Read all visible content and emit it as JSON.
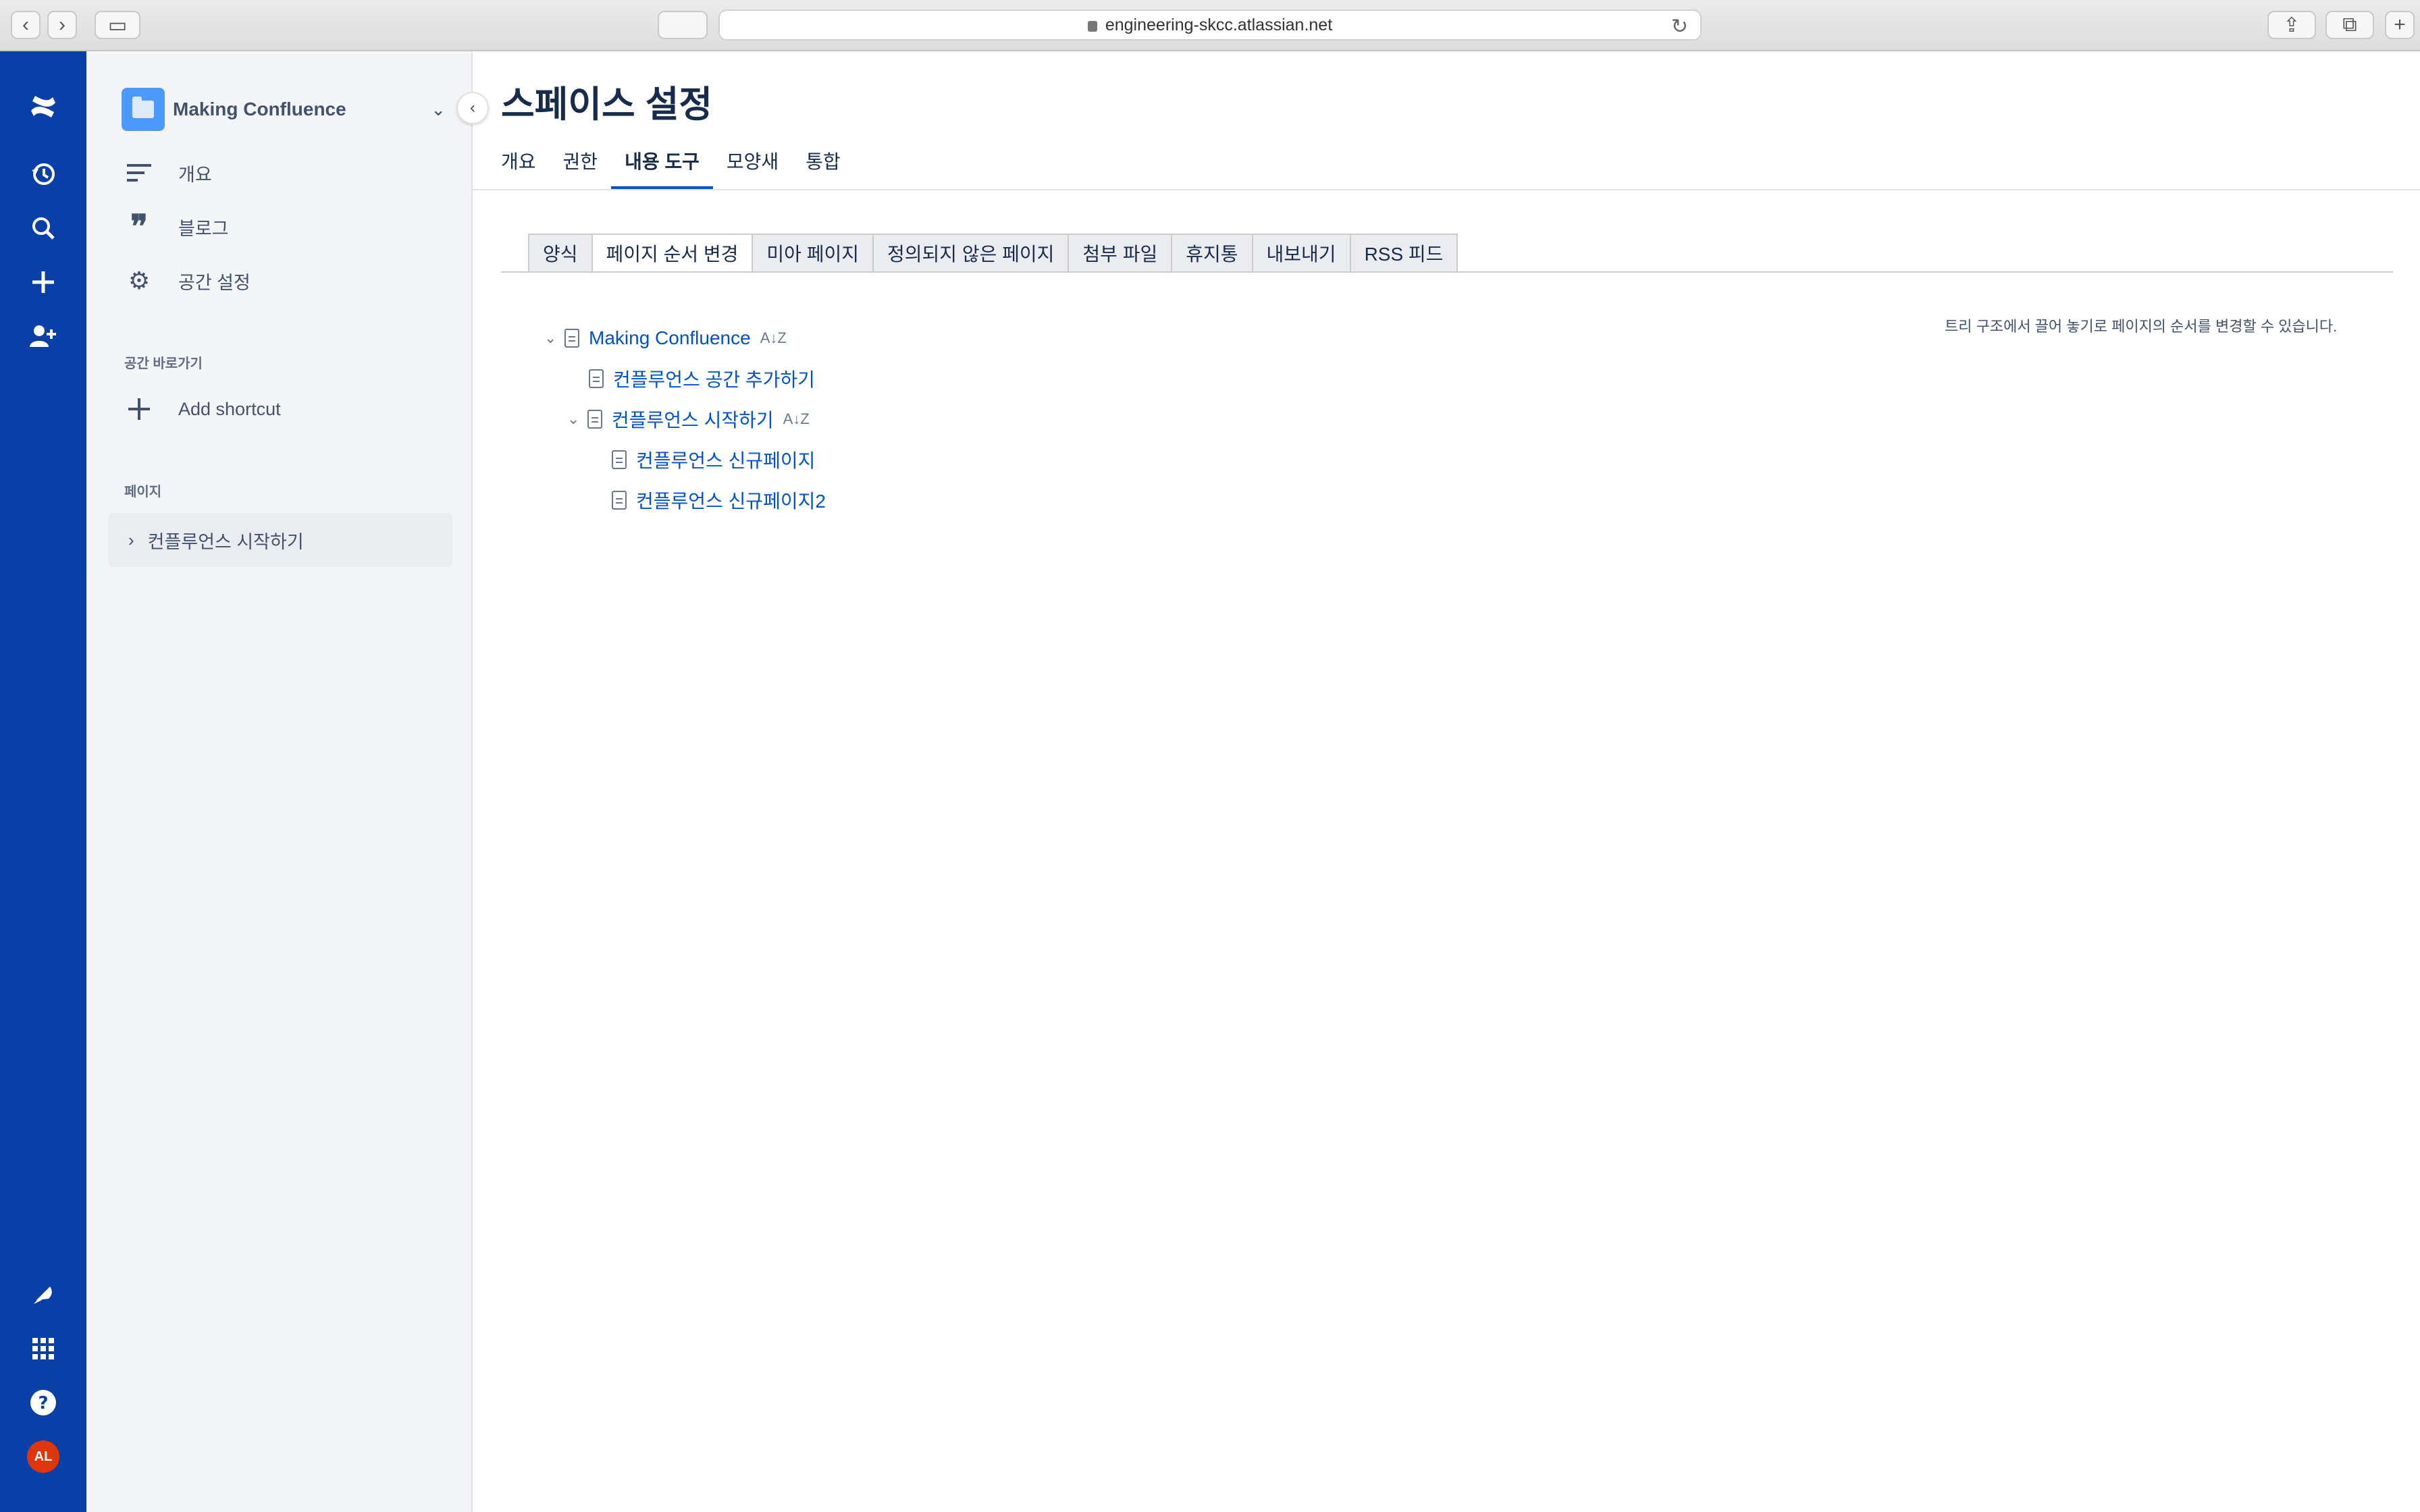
{
  "browser": {
    "url": "engineering-skcc.atlassian.net"
  },
  "gnav": {
    "icons": [
      "confluence-logo-icon",
      "history-icon",
      "search-icon",
      "plus-icon",
      "add-people-icon",
      "notification-icon",
      "app-switcher-icon",
      "help-icon"
    ],
    "avatar_initials": "AL"
  },
  "sidebar": {
    "space_name": "Making Confluence",
    "items": [
      {
        "label": "개요",
        "icon": "overview-icon"
      },
      {
        "label": "블로그",
        "icon": "blog-quote-icon"
      },
      {
        "label": "공간 설정",
        "icon": "gear-icon"
      }
    ],
    "shortcuts_heading": "공간 바로가기",
    "add_shortcut": "Add shortcut",
    "pages_heading": "페이지",
    "pages": [
      {
        "label": "컨플루언스 시작하기"
      }
    ]
  },
  "main": {
    "title": "스페이스 설정",
    "tabs": [
      {
        "label": "개요"
      },
      {
        "label": "권한"
      },
      {
        "label": "내용 도구",
        "active": true
      },
      {
        "label": "모양새"
      },
      {
        "label": "통합"
      }
    ],
    "sub_tabs": [
      {
        "label": "양식"
      },
      {
        "label": "페이지 순서 변경",
        "active": true
      },
      {
        "label": "미아 페이지"
      },
      {
        "label": "정의되지 않은 페이지"
      },
      {
        "label": "첨부 파일"
      },
      {
        "label": "휴지통"
      },
      {
        "label": "내보내기"
      },
      {
        "label": "RSS 피드"
      }
    ],
    "hint": "트리 구조에서 끌어 놓기로 페이지의 순서를 변경할 수 있습니다.",
    "tree": [
      {
        "label": "Making Confluence",
        "expanded": true,
        "home": true
      },
      {
        "label": "컨플루언스 공간 추가하기"
      },
      {
        "label": "컨플루언스 시작하기",
        "expanded": true
      },
      {
        "label": "컨플루언스 신규페이지"
      },
      {
        "label": "컨플루언스 신규페이지2"
      }
    ]
  },
  "colors": {
    "nav_bg": "#0b3fa8",
    "link": "#0052cc",
    "active_tab_underline": "#0052cc",
    "avatar_bg": "#de350b"
  }
}
